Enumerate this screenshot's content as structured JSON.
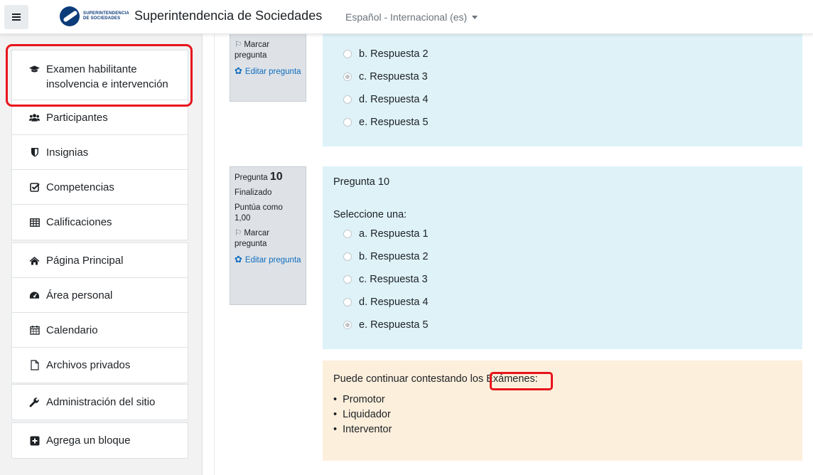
{
  "navbar": {
    "menu_icon": "hamburger-icon",
    "logo_text": "SUPERINTENDENCIA DE SOCIEDADES",
    "site_name": "Superintendencia de Sociedades",
    "language": "Español - Internacional (es)"
  },
  "drawer": {
    "course": {
      "icon": "graduation-cap-icon",
      "label": "Examen habilitante insolvencia e intervención"
    },
    "course_items": [
      {
        "icon": "users-icon",
        "label": "Participantes"
      },
      {
        "icon": "shield-icon",
        "label": "Insignias"
      },
      {
        "icon": "checkbox-icon",
        "label": "Competencias"
      },
      {
        "icon": "table-icon",
        "label": "Calificaciones"
      }
    ],
    "site_items": [
      {
        "icon": "home-icon",
        "label": "Página Principal"
      },
      {
        "icon": "dashboard-icon",
        "label": "Área personal"
      },
      {
        "icon": "calendar-icon",
        "label": "Calendario"
      },
      {
        "icon": "file-icon",
        "label": "Archivos privados"
      }
    ],
    "admin": {
      "icon": "wrench-icon",
      "label": "Administración del sitio"
    },
    "add_block": {
      "icon": "plus-square-icon",
      "label": "Agrega un bloque"
    }
  },
  "question9": {
    "flag_label": "Marcar pregunta",
    "edit_label": "Editar pregunta",
    "options": [
      {
        "label": "b. Respuesta 2",
        "selected": false
      },
      {
        "label": "c. Respuesta 3",
        "selected": true
      },
      {
        "label": "d. Respuesta 4",
        "selected": false
      },
      {
        "label": "e. Respuesta 5",
        "selected": false
      }
    ]
  },
  "question10": {
    "info_prefix": "Pregunta",
    "number": "10",
    "state": "Finalizado",
    "grade": "Puntúa como 1,00",
    "flag_label": "Marcar pregunta",
    "edit_label": "Editar pregunta",
    "title": "Pregunta 10",
    "prompt": "Seleccione una:",
    "options": [
      {
        "label": "a. Respuesta 1",
        "selected": false
      },
      {
        "label": "b. Respuesta 2",
        "selected": false
      },
      {
        "label": "c. Respuesta 3",
        "selected": false
      },
      {
        "label": "d. Respuesta 4",
        "selected": false
      },
      {
        "label": "e. Respuesta 5",
        "selected": true
      }
    ]
  },
  "feedback": {
    "text": "Puede continuar contestando los Exámenes:",
    "items": [
      "Promotor",
      "Liquidador",
      "Interventor"
    ]
  },
  "colors": {
    "highlight": "#e8141b",
    "question_bg": "#def2f8",
    "feedback_bg": "#fcefdc",
    "link": "#0f6cbf"
  }
}
